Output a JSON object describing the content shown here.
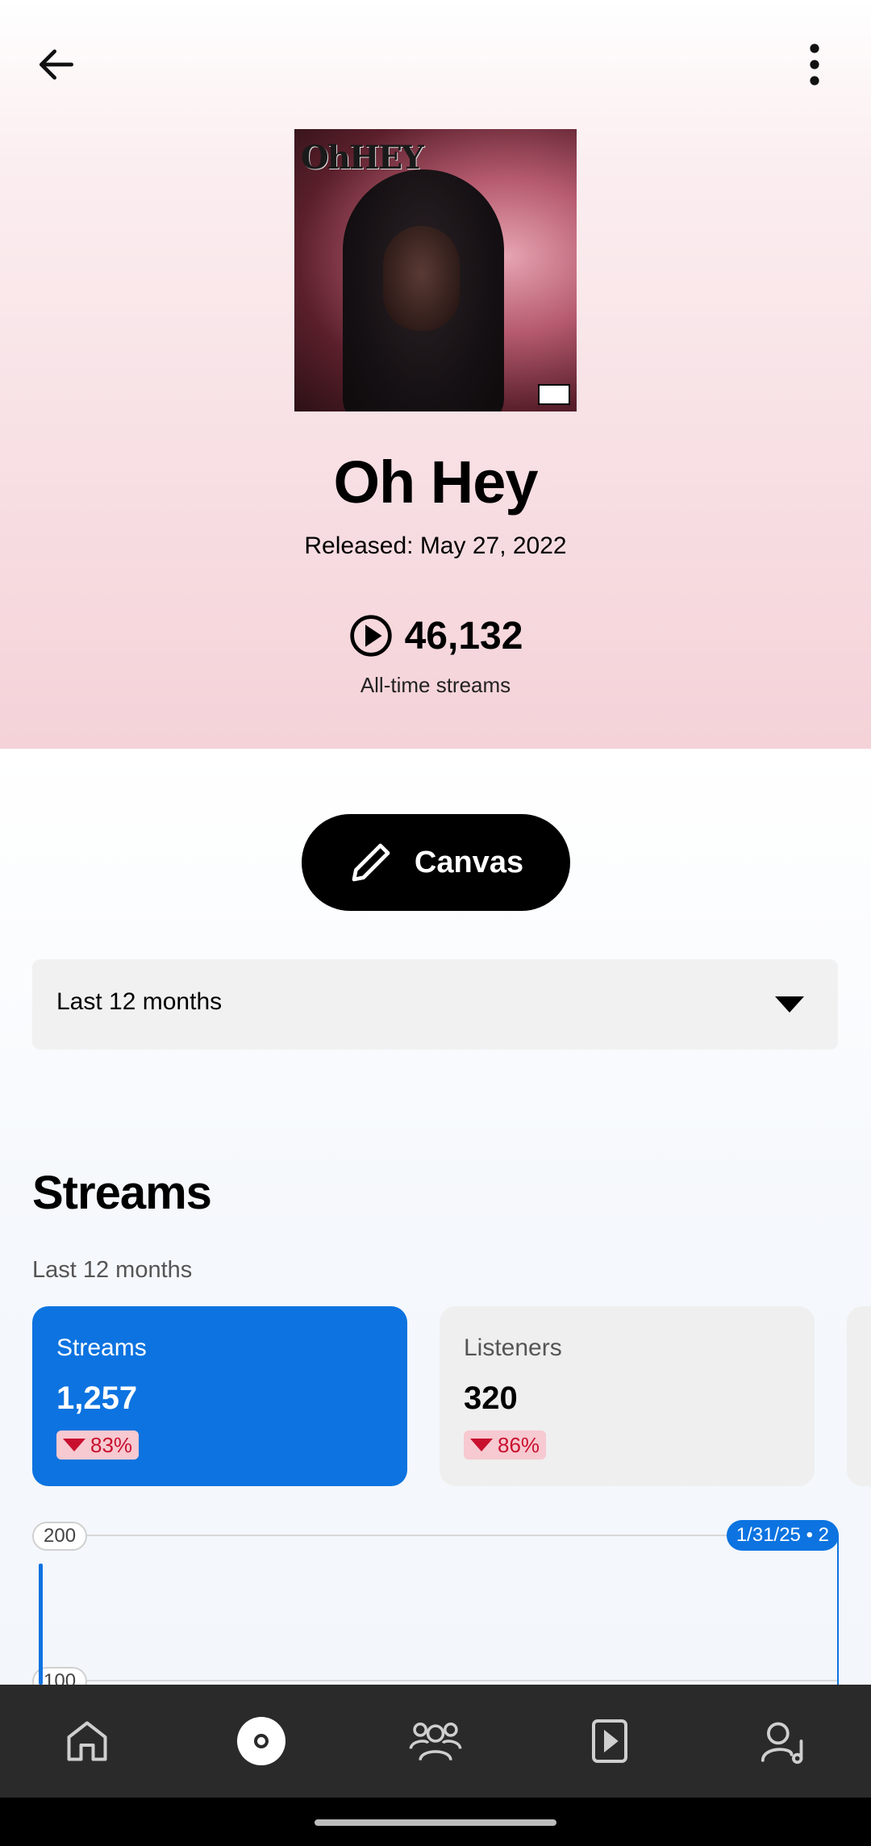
{
  "track": {
    "title": "Oh Hey",
    "released": "Released: May 27, 2022",
    "all_time_streams": "46,132",
    "all_time_label": "All-time streams",
    "cover_logo_text": "OhHEY"
  },
  "actions": {
    "canvas_label": "Canvas"
  },
  "filter": {
    "selected": "Last 12 months"
  },
  "streams_section": {
    "title": "Streams",
    "subtitle": "Last 12 months",
    "cards": [
      {
        "label": "Streams",
        "value": "1,257",
        "change": "83%",
        "trend": "down"
      },
      {
        "label": "Listeners",
        "value": "320",
        "change": "86%",
        "trend": "down"
      }
    ]
  },
  "chart_data": {
    "type": "line",
    "ylim": [
      0,
      200
    ],
    "y_ticks": [
      "200",
      "100"
    ],
    "tooltip": "1/31/25 • 2",
    "series": [
      {
        "values": [
          2
        ]
      }
    ]
  },
  "colors": {
    "accent": "#0c73e0",
    "negative": "#c8102e",
    "hero_gradient_end": "#f4d2d8"
  },
  "nav": {
    "items": [
      "home-icon",
      "release-icon",
      "audience-icon",
      "video-icon",
      "profile-icon"
    ],
    "active": "release-icon"
  }
}
